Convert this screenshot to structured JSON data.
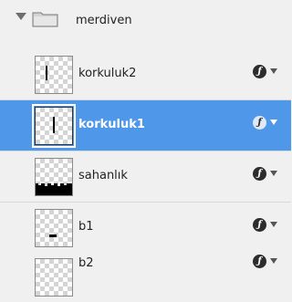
{
  "group": {
    "label": "merdiven",
    "expanded": true
  },
  "layers": [
    {
      "label": "korkuluk2",
      "selected": false,
      "fx": "ƒ"
    },
    {
      "label": "korkuluk1",
      "selected": true,
      "fx": "ƒ"
    },
    {
      "label": "sahanlık",
      "selected": false,
      "fx": "ƒ"
    },
    {
      "label": "b1",
      "selected": false,
      "fx": "ƒ"
    },
    {
      "label": "b2",
      "selected": false,
      "fx": "ƒ"
    }
  ],
  "colors": {
    "selection": "#4f97e8",
    "panel": "#f0f0f0"
  }
}
